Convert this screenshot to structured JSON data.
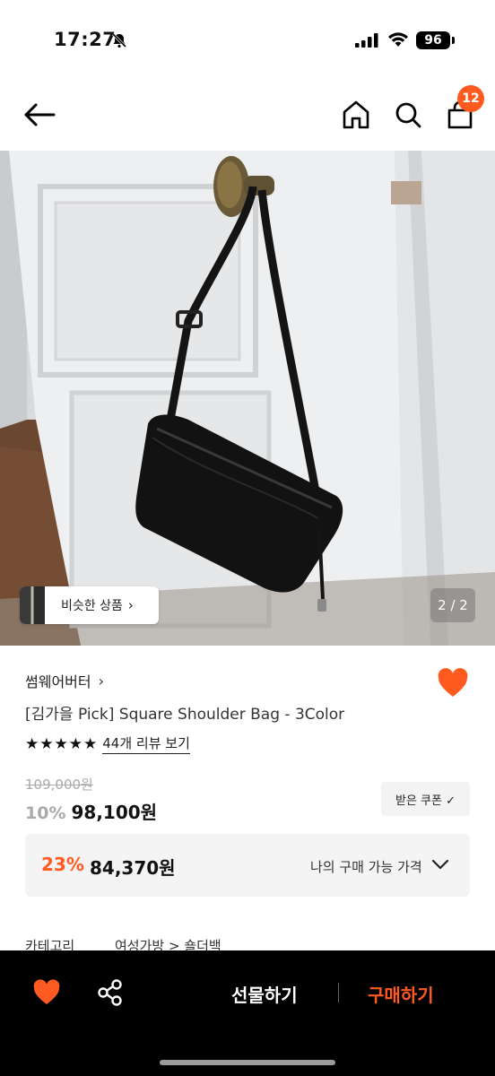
{
  "status_bar": {
    "time": "17:27",
    "battery": "96"
  },
  "nav": {
    "cart_count": "12"
  },
  "gallery": {
    "similar_label": "비슷한 상품",
    "similar_chevron": "›",
    "page_counter": "2 / 2"
  },
  "product": {
    "brand": "썸웨어버터",
    "brand_chevron": "›",
    "title": "[김가을 Pick] Square Shoulder Bag - 3Color",
    "rating_stars": 5,
    "review_link": "44개 리뷰 보기",
    "original_price": "109,000원",
    "discount_rate": "10%",
    "sale_price": "98,100원",
    "coupon_label": "받은 쿠폰 ✓"
  },
  "my_price": {
    "discount": "23%",
    "price": "84,370원",
    "label": "나의 구매 가능 가격"
  },
  "category": {
    "key": "카테고리",
    "value": "여성가방 > 숄더백"
  },
  "bottom_bar": {
    "gift_label": "선물하기",
    "buy_label": "구매하기"
  },
  "colors": {
    "accent": "#ff5a1f",
    "bottom_bar_bg": "#000000"
  },
  "icons": [
    "bell-off-icon",
    "signal-icon",
    "wifi-icon",
    "back-arrow-icon",
    "home-icon",
    "search-icon",
    "cart-icon",
    "heart-icon",
    "share-icon",
    "chevron-down-icon",
    "star-icon"
  ]
}
